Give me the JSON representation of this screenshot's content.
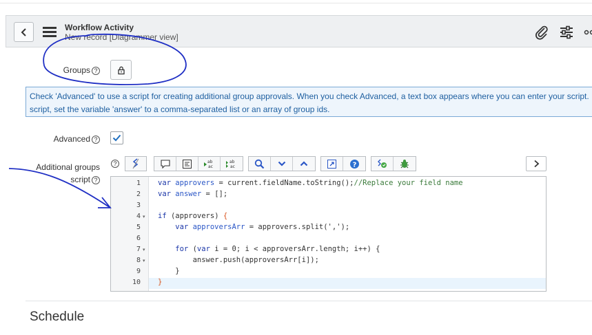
{
  "header": {
    "title": "Workflow Activity",
    "subtitle": "New record [Diagrammer view]"
  },
  "form": {
    "groups_label": "Groups",
    "info_line1": "Check 'Advanced' to use a script for creating additional group approvals. When you check Advanced, a text box appears where you can enter your script. In",
    "info_line2": "script, set the variable 'answer' to a comma-separated list or an array of group ids.",
    "advanced_label": "Advanced",
    "advanced_checked": true,
    "script_label_line1": "Additional groups",
    "script_label_line2": "script"
  },
  "editor": {
    "line_numbers": [
      "1",
      "2",
      "3",
      "4",
      "5",
      "6",
      "7",
      "8",
      "9",
      "10"
    ],
    "lines": [
      {
        "parts": [
          {
            "t": "var ",
            "c": "kw"
          },
          {
            "t": "approvers",
            "c": "vr"
          },
          {
            "t": " = current.fieldName.toString();",
            "c": "pl"
          },
          {
            "t": "//Replace your field name",
            "c": "cm"
          }
        ]
      },
      {
        "parts": [
          {
            "t": "var ",
            "c": "kw"
          },
          {
            "t": "answer",
            "c": "vr"
          },
          {
            "t": " = [];",
            "c": "pl"
          }
        ]
      },
      {
        "parts": []
      },
      {
        "parts": [
          {
            "t": "if",
            "c": "kw"
          },
          {
            "t": " (approvers) ",
            "c": "pl"
          },
          {
            "t": "{",
            "c": "br"
          }
        ]
      },
      {
        "parts": [
          {
            "t": "    var ",
            "c": "kw"
          },
          {
            "t": "approversArr",
            "c": "vr"
          },
          {
            "t": " = approvers.split(',');",
            "c": "pl"
          }
        ]
      },
      {
        "parts": []
      },
      {
        "parts": [
          {
            "t": "    for",
            "c": "kw"
          },
          {
            "t": " (",
            "c": "pl"
          },
          {
            "t": "var",
            "c": "kw"
          },
          {
            "t": " i = 0; i < approversArr.length; i++) {",
            "c": "pl"
          }
        ]
      },
      {
        "parts": [
          {
            "t": "        answer.push(approversArr[i]);",
            "c": "pl"
          }
        ]
      },
      {
        "parts": [
          {
            "t": "    }",
            "c": "pl"
          }
        ]
      },
      {
        "parts": [
          {
            "t": "}",
            "c": "br"
          }
        ]
      }
    ],
    "fold_lines": [
      4,
      7,
      8
    ]
  },
  "section": {
    "schedule_title": "Schedule"
  },
  "colors": {
    "accent": "#1e5fa0",
    "annotation": "#1f2fc4",
    "checkmark": "#1f6fc0"
  }
}
